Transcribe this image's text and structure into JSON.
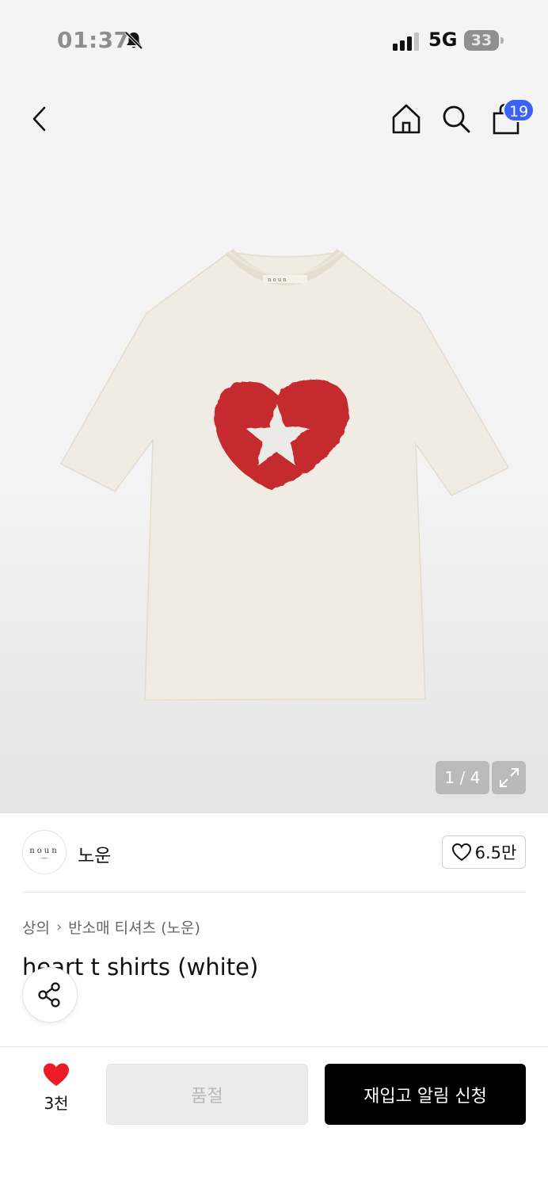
{
  "status_bar": {
    "time": "01:37",
    "network": "5G",
    "battery": "33"
  },
  "header": {
    "cart_count": "19"
  },
  "gallery": {
    "page_indicator": "1 / 4",
    "current_page": 1,
    "total_pages": 4
  },
  "brand": {
    "logo_text": "noun",
    "name": "노운",
    "likes": "6.5만"
  },
  "breadcrumb": {
    "items": [
      "상의",
      "반소매 티셔츠 (노운)"
    ]
  },
  "product": {
    "title": "heart t shirts (white)"
  },
  "bottom_bar": {
    "wish_count": "3천",
    "soldout_label": "품절",
    "restock_label": "재입고 알림 신청"
  },
  "colors": {
    "accent_badge": "#3a63f3",
    "heart": "#ec1c24",
    "primary_button": "#000000",
    "shirt": "#f1ece3",
    "print_red": "#c42a2e"
  },
  "icons": [
    "bell-slash-icon",
    "signal-icon",
    "battery-icon",
    "back-chevron-icon",
    "home-icon",
    "search-icon",
    "shopping-bag-icon",
    "expand-icon",
    "heart-outline-icon",
    "chevron-right-icon",
    "share-icon",
    "heart-filled-icon"
  ]
}
